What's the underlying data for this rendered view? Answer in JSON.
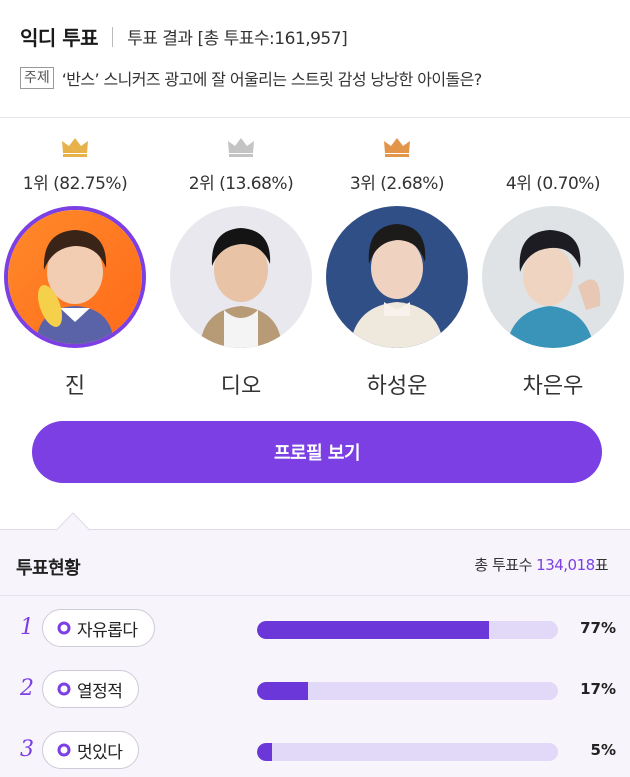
{
  "header": {
    "brand": "익디 투표",
    "subtitle": "투표 결과 [총 투표수:161,957]",
    "topic_tag": "주제",
    "topic_text": "‘반스’ 스니커즈 광고에 잘 어울리는 스트릿 감성 낭낭한 아이돌은?"
  },
  "ranking": [
    {
      "label": "1위 (82.75%)",
      "name": "진",
      "crown": "gold-crown-icon",
      "crown_color": "#e8b24a"
    },
    {
      "label": "2위 (13.68%)",
      "name": "디오",
      "crown": "silver-crown-icon",
      "crown_color": "#c4c4c4"
    },
    {
      "label": "3위 (2.68%)",
      "name": "하성운",
      "crown": "bronze-crown-icon",
      "crown_color": "#e3964a"
    },
    {
      "label": "4위 (0.70%)",
      "name": "차은우"
    }
  ],
  "profile_button": "프로필 보기",
  "status": {
    "title": "투표현황",
    "total_prefix": "총 투표수",
    "total_value": "134,018",
    "total_suffix": "표",
    "items": [
      {
        "rank": "1",
        "label": "자유롭다",
        "percent": "77%",
        "value": 0.77
      },
      {
        "rank": "2",
        "label": "열정적",
        "percent": "17%",
        "value": 0.17
      },
      {
        "rank": "3",
        "label": "멋있다",
        "percent": "5%",
        "value": 0.05
      }
    ]
  },
  "colors": {
    "accent": "#7b3fe4",
    "bar_track": "#e2d8f7",
    "bar_fill": "#6b37d8"
  }
}
